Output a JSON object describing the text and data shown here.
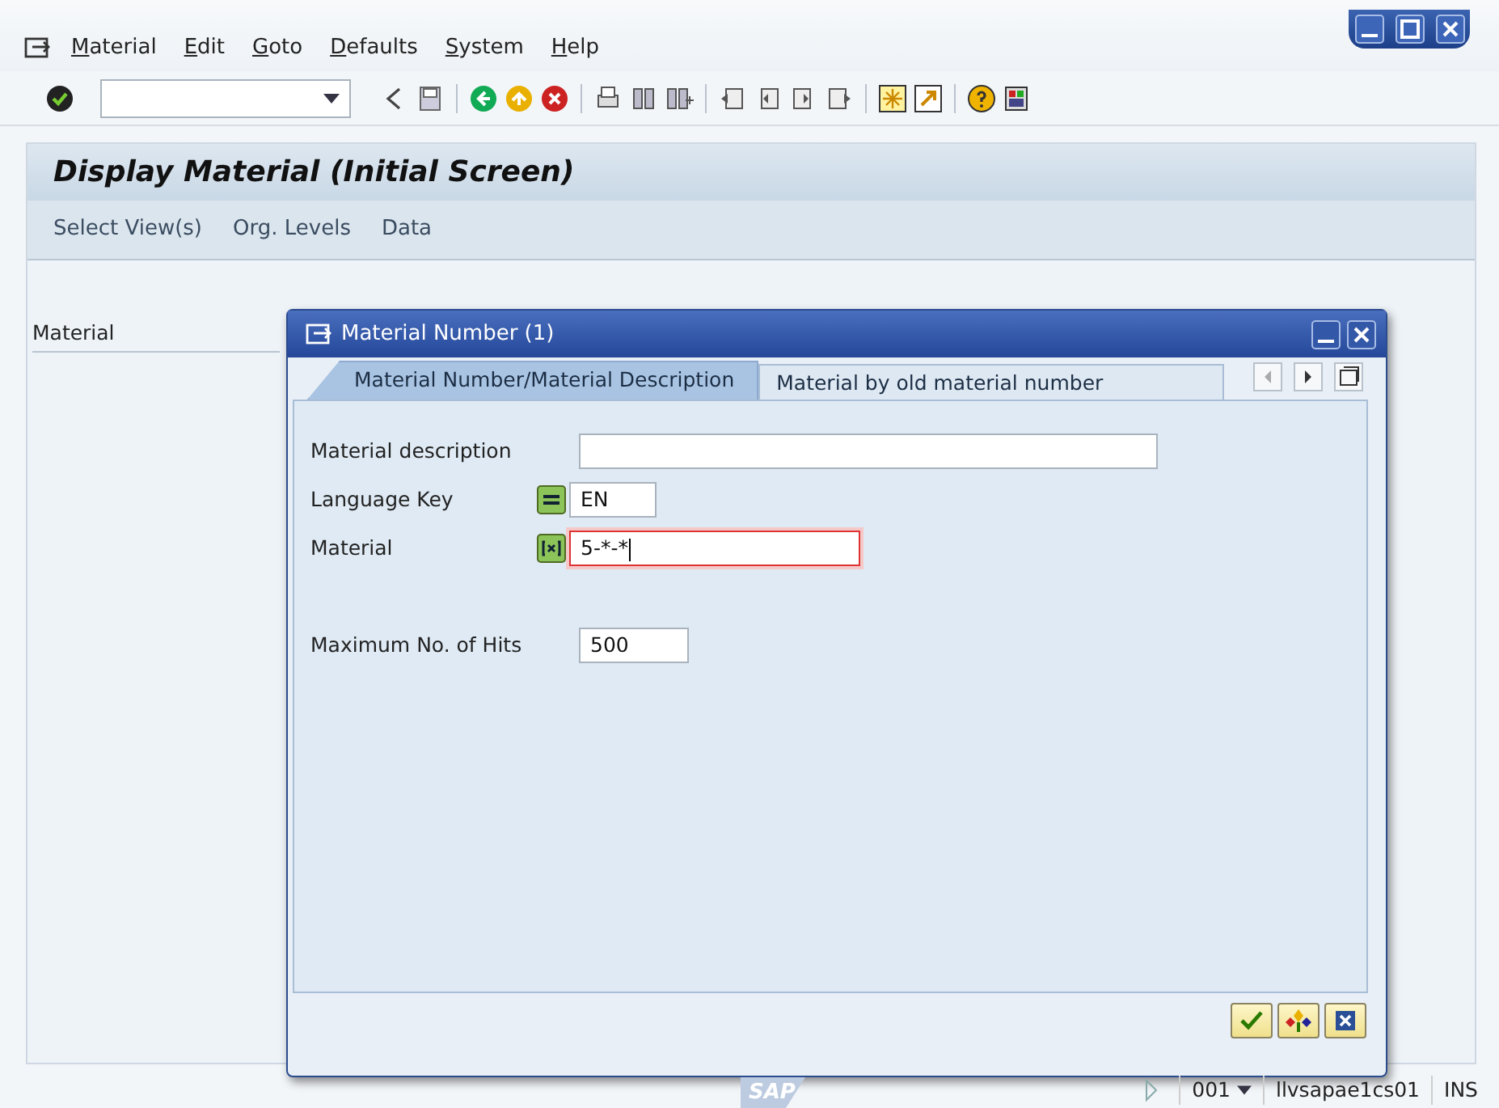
{
  "menu_bar": {
    "items": [
      "Material",
      "Edit",
      "Goto",
      "Defaults",
      "System",
      "Help"
    ]
  },
  "screen": {
    "title": "Display Material (Initial Screen)",
    "app_toolbar": [
      "Select View(s)",
      "Org. Levels",
      "Data"
    ],
    "fields": [
      {
        "label": "Material"
      }
    ]
  },
  "dialog": {
    "title": "Material Number (1)",
    "tabs": [
      {
        "label": "Material Number/Material Description",
        "selected": true
      },
      {
        "label": "Material by old material number",
        "selected": false
      }
    ],
    "fields": [
      {
        "label": "Material description",
        "kind": "wide"
      },
      {
        "label": "Language Key",
        "value": "EN",
        "kind": "equals",
        "focused": false
      },
      {
        "label": "Material",
        "value": "5-*-*",
        "kind": "pattern",
        "focused": true
      },
      {
        "label": "Maximum No. of Hits",
        "value": "500",
        "kind": "short",
        "gap": true
      }
    ]
  },
  "status_bar": {
    "logo": "SAP",
    "client": "001",
    "server": "llvsapae1cs01",
    "mode": "INS"
  }
}
